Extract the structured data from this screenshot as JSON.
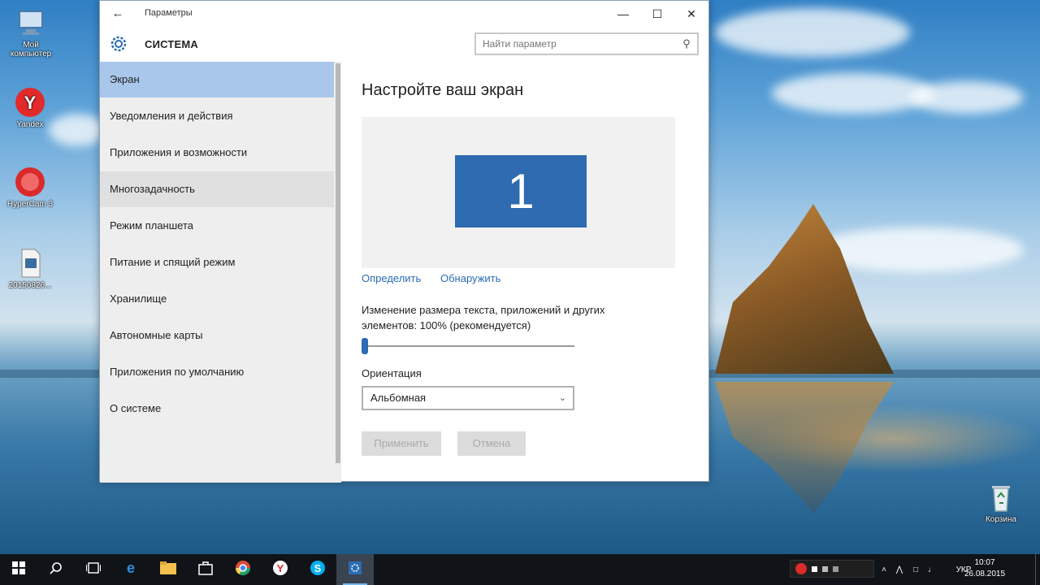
{
  "desktop": {
    "icons": [
      {
        "name": "my-computer",
        "label": "Мой компьютер"
      },
      {
        "name": "yandex",
        "label": "Yandex"
      },
      {
        "name": "hypercam",
        "label": "HyperCam 3"
      },
      {
        "name": "video-file",
        "label": "20150826..."
      },
      {
        "name": "recycle-bin",
        "label": "Корзина"
      }
    ]
  },
  "window": {
    "title": "Параметры",
    "back_icon": "back-arrow-icon",
    "minimize_label": "—",
    "maximize_label": "☐",
    "close_label": "✕"
  },
  "header": {
    "icon": "gear-icon",
    "section_title": "СИСТЕМА",
    "search_placeholder": "Найти параметр"
  },
  "sidebar": {
    "items": [
      {
        "label": "Экран",
        "state": "selected"
      },
      {
        "label": "Уведомления и действия",
        "state": "normal"
      },
      {
        "label": "Приложения и возможности",
        "state": "normal"
      },
      {
        "label": "Многозадачность",
        "state": "hover"
      },
      {
        "label": "Режим планшета",
        "state": "normal"
      },
      {
        "label": "Питание и спящий режим",
        "state": "normal"
      },
      {
        "label": "Хранилище",
        "state": "normal"
      },
      {
        "label": "Автономные карты",
        "state": "normal"
      },
      {
        "label": "Приложения по умолчанию",
        "state": "normal"
      },
      {
        "label": "О системе",
        "state": "normal"
      }
    ]
  },
  "content": {
    "title": "Настройте ваш экран",
    "monitor_number": "1",
    "identify_link": "Определить",
    "detect_link": "Обнаружить",
    "scale_text_line1": "Изменение размера текста, приложений и других",
    "scale_text_line2": "элементов: 100% (рекомендуется)",
    "scale_level": 0.0,
    "orientation_label": "Ориентация",
    "orientation_value": "Альбомная",
    "apply_label": "Применить",
    "cancel_label": "Отмена"
  },
  "taskbar": {
    "items": [
      "windows-start-icon",
      "search-icon",
      "task-view-icon",
      "edge-icon",
      "file-explorer-icon",
      "store-icon",
      "chrome-icon",
      "yandex-browser-icon",
      "skype-icon",
      "settings-icon"
    ],
    "active": "settings-icon",
    "language": "УКР",
    "time": "10:07",
    "date": "26.08.2015"
  },
  "colors": {
    "accent": "#2b6cb3",
    "selected_nav": "#a9c7ea",
    "taskbar": "#101418"
  }
}
